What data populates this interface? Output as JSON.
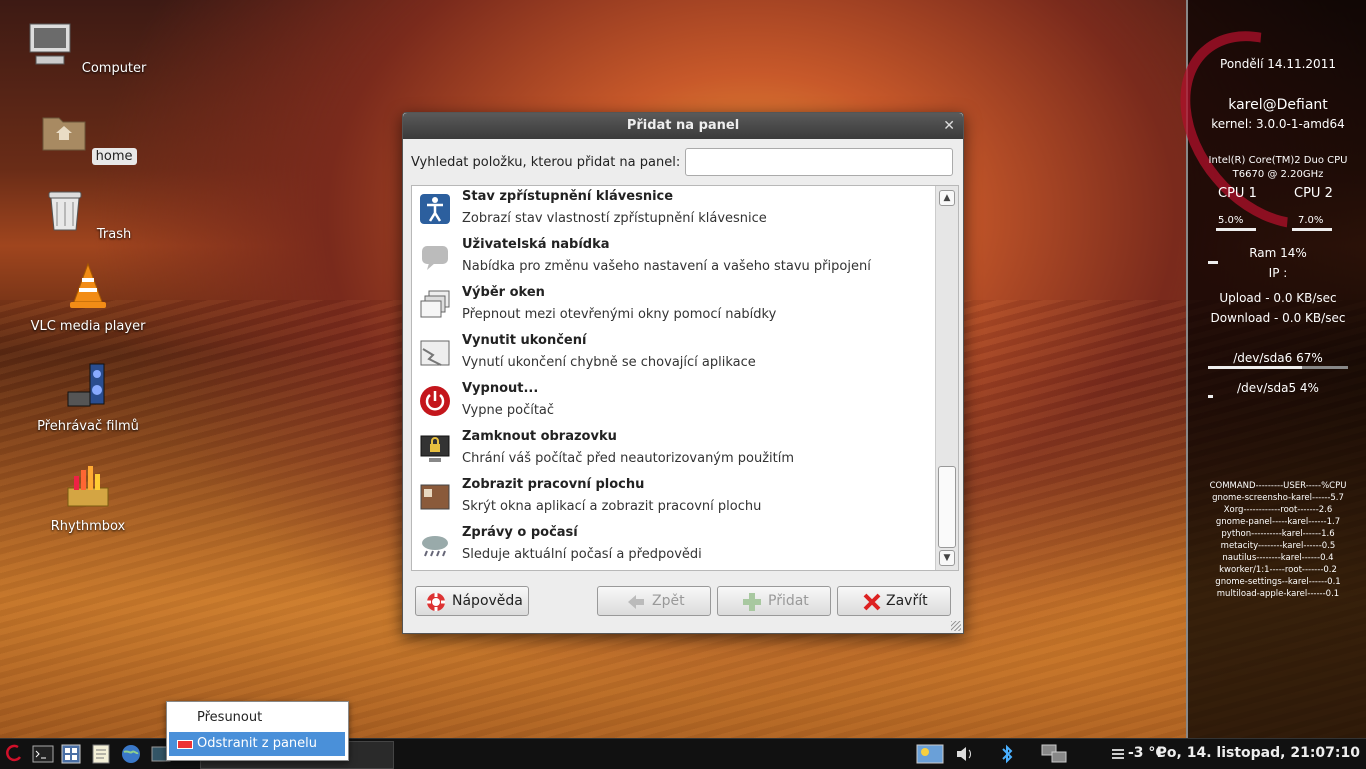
{
  "desktop": {
    "icons": [
      {
        "label": "Computer"
      },
      {
        "label": "home"
      },
      {
        "label": "Trash"
      },
      {
        "label": "VLC media player"
      },
      {
        "label": "Přehrávač filmů"
      },
      {
        "label": "Rhythmbox"
      }
    ]
  },
  "conky": {
    "date": "Pondělí 14.11.2011",
    "user": "karel@Defiant",
    "kernel": "kernel: 3.0.0-1-amd64",
    "cpu_model": "Intel(R) Core(TM)2 Duo CPU",
    "cpu_speed": "T6670  @ 2.20GHz",
    "cpu1_label": "CPU 1",
    "cpu2_label": "CPU 2",
    "cpu1_value": "5.0%",
    "cpu2_value": "7.0%",
    "ram": "Ram 14%",
    "ip": "IP :",
    "upload": "Upload - 0.0 KB/sec",
    "download": "Download - 0.0 KB/sec",
    "sda6": "/dev/sda6 67%",
    "sda6_fraction": 0.67,
    "sda5": "/dev/sda5 4%",
    "sda5_fraction": 0.04,
    "ram_fraction": 0.14,
    "processes": [
      "COMMAND---------USER-----%CPU",
      "gnome-screensho-karel------5.7",
      "Xorg------------root-------2.6",
      "gnome-panel-----karel------1.7",
      "python----------karel------1.6",
      "metacity--------karel------0.5",
      "nautilus--------karel------0.4",
      "kworker/1:1-----root-------0.2",
      "gnome-settings--karel------0.1",
      "multiload-apple-karel------0.1"
    ]
  },
  "dialog": {
    "title": "Přidat na panel",
    "search_label": "Vyhledat položku, kterou přidat na panel:",
    "search_value": "",
    "items": [
      {
        "title": "Stav zpřístupnění klávesnice",
        "desc": "Zobrazí stav vlastností zpřístupnění klávesnice",
        "icon": "accessibility-icon"
      },
      {
        "title": "Uživatelská nabídka",
        "desc": "Nabídka pro změnu vašeho nastavení a vašeho stavu připojení",
        "icon": "user-menu-icon"
      },
      {
        "title": "Výběr oken",
        "desc": "Přepnout mezi otevřenými okny pomocí nabídky",
        "icon": "window-selector-icon"
      },
      {
        "title": "Vynutit ukončení",
        "desc": "Vynutí ukončení chybně se chovající aplikace",
        "icon": "force-quit-icon"
      },
      {
        "title": "Vypnout...",
        "desc": "Vypne počítač",
        "icon": "power-icon"
      },
      {
        "title": "Zamknout obrazovku",
        "desc": "Chrání váš počítač před neautorizovaným použitím",
        "icon": "lock-screen-icon"
      },
      {
        "title": "Zobrazit pracovní plochu",
        "desc": "Skrýt okna aplikací a zobrazit pracovní plochu",
        "icon": "show-desktop-icon"
      },
      {
        "title": "Zprávy o počasí",
        "desc": "Sleduje aktuální počasí a předpovědi",
        "icon": "weather-icon"
      }
    ],
    "buttons": {
      "help": "Nápověda",
      "back": "Zpět",
      "add": "Přidat",
      "close": "Zavřít"
    }
  },
  "context_menu": {
    "items": [
      {
        "label": "Přesunout"
      },
      {
        "label": "Odstranit z panelu"
      }
    ]
  },
  "panel": {
    "temperature": "-3 °C",
    "clock": "Po, 14. listopad, 21:07:10"
  },
  "colors": {
    "menu_highlight": "#4a90d9",
    "debian_red": "#b0102a"
  }
}
